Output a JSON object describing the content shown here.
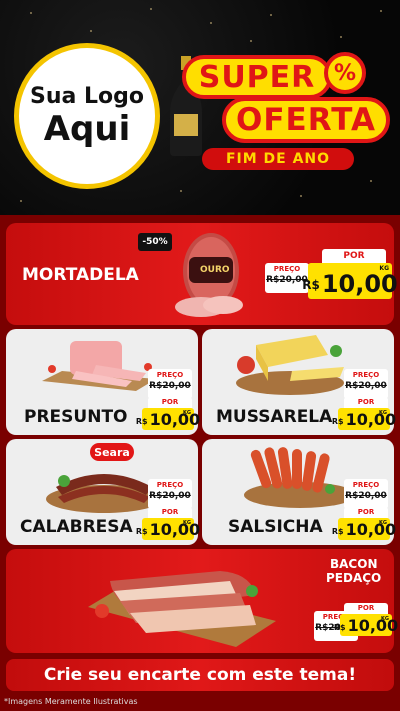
{
  "header": {
    "logo_line1": "Sua Logo",
    "logo_line2": "Aqui",
    "badge_super": "SUPER",
    "badge_percent": "%",
    "badge_oferta": "OFERTA",
    "badge_fim": "FIM DE ANO"
  },
  "featured": {
    "name": "MORTADELA",
    "discount": "-50%",
    "brand": "OURO",
    "preco_label": "PREÇO",
    "old_price": "R$20,00",
    "por_label": "POR",
    "currency": "R$",
    "price": "10,00",
    "unit": "KG"
  },
  "products": [
    {
      "name": "PRESUNTO",
      "preco_label": "PREÇO",
      "old_price": "R$20,00",
      "por_label": "POR",
      "currency": "R$",
      "price": "10,00",
      "unit": "KG"
    },
    {
      "name": "MUSSARELA",
      "preco_label": "PREÇO",
      "old_price": "R$20,00",
      "por_label": "POR",
      "currency": "R$",
      "price": "10,00",
      "unit": "KG"
    },
    {
      "name": "CALABRESA",
      "brand": "Seara",
      "preco_label": "PREÇO",
      "old_price": "R$20,00",
      "por_label": "POR",
      "currency": "R$",
      "price": "10,00",
      "unit": "KG"
    },
    {
      "name": "SALSICHA",
      "preco_label": "PREÇO",
      "old_price": "R$20,00",
      "por_label": "POR",
      "currency": "R$",
      "price": "10,00",
      "unit": "KG"
    }
  ],
  "bacon": {
    "name_line1": "BACON",
    "name_line2": "PEDAÇO",
    "preco_label": "PREÇO",
    "old_price": "R$20,00",
    "por_label": "POR",
    "currency": "R$",
    "price": "10,00",
    "unit": "KG"
  },
  "footer": {
    "cta": "Crie seu encarte com este tema!",
    "note": "*Imagens Meramente Ilustrativas"
  },
  "colors": {
    "red": "#e01616",
    "yellow": "#ffe100",
    "dark_red": "#7a0000",
    "grey_card": "#eeeeee"
  }
}
